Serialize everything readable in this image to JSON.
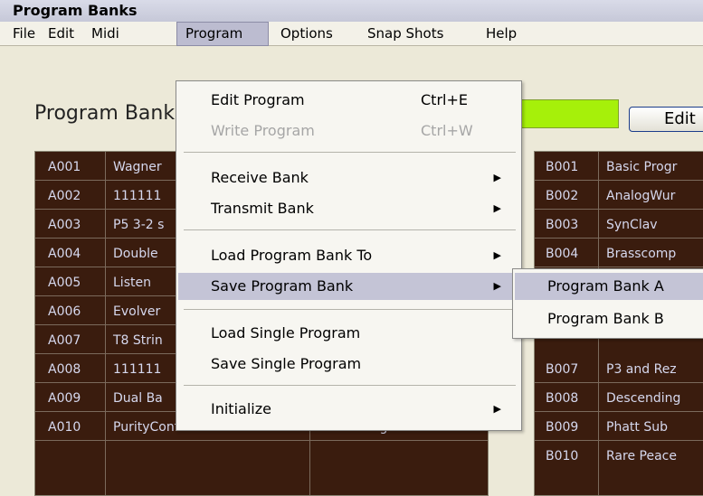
{
  "window": {
    "title": "Program Banks"
  },
  "menubar": {
    "items": [
      {
        "label": "File"
      },
      {
        "label": "Edit"
      },
      {
        "label": "Midi"
      },
      {
        "label": "Program"
      },
      {
        "label": "Options"
      },
      {
        "label": "Snap Shots"
      },
      {
        "label": "Help"
      }
    ]
  },
  "header": {
    "label": "Program Banks",
    "edit_button": "Edit"
  },
  "bank_a": {
    "rows": [
      {
        "id": "A001",
        "name": "Wagner",
        "assign": ""
      },
      {
        "id": "A002",
        "name": "111111",
        "assign": ""
      },
      {
        "id": "A003",
        "name": "P5 3-2 s",
        "assign": ""
      },
      {
        "id": "A004",
        "name": "Double",
        "assign": ""
      },
      {
        "id": "A005",
        "name": "Listen",
        "assign": ""
      },
      {
        "id": "A006",
        "name": "Evolver",
        "assign": ""
      },
      {
        "id": "A007",
        "name": "T8 Strin",
        "assign": ""
      },
      {
        "id": "A008",
        "name": "111111",
        "assign": ""
      },
      {
        "id": "A009",
        "name": "Dual Ba",
        "assign": ""
      },
      {
        "id": "A010",
        "name": "PurityControl",
        "assign": "- Not Assigned -"
      }
    ]
  },
  "bank_b": {
    "rows": [
      {
        "id": "B001",
        "name": "Basic Progr"
      },
      {
        "id": "B002",
        "name": "AnalogWur"
      },
      {
        "id": "B003",
        "name": "SynClav"
      },
      {
        "id": "B004",
        "name": "Brasscomp"
      },
      {
        "id": "B005",
        "name": ""
      },
      {
        "id": "B006",
        "name": ""
      },
      {
        "id": "B007",
        "name": "P3 and Rez"
      },
      {
        "id": "B008",
        "name": "Descending"
      },
      {
        "id": "B009",
        "name": "Phatt Sub"
      },
      {
        "id": "B010",
        "name": "Rare Peace"
      }
    ]
  },
  "program_menu": {
    "edit_program": {
      "label": "Edit Program",
      "shortcut": "Ctrl+E"
    },
    "write_program": {
      "label": "Write Program",
      "shortcut": "Ctrl+W"
    },
    "receive_bank": {
      "label": "Receive Bank"
    },
    "transmit_bank": {
      "label": "Transmit Bank"
    },
    "load_program_bank": {
      "label": "Load Program Bank To"
    },
    "save_program_bank": {
      "label": "Save Program Bank"
    },
    "load_single": {
      "label": "Load Single Program"
    },
    "save_single": {
      "label": "Save Single Program"
    },
    "initialize": {
      "label": "Initialize"
    },
    "arrow_glyph": "▶"
  },
  "save_submenu": {
    "items": [
      {
        "label": "Program Bank A"
      },
      {
        "label": "Program Bank B"
      }
    ]
  },
  "colors": {
    "grid_bg": "#3a1c0e",
    "grid_text": "#d6d8ee",
    "highlight": "#c4c4d6",
    "status_green": "#a6f00a"
  }
}
